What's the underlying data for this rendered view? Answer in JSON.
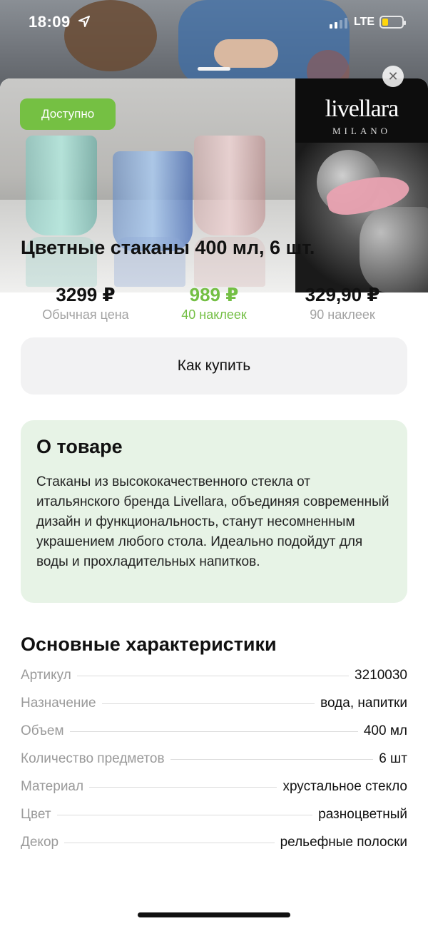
{
  "status_bar": {
    "time": "18:09",
    "network": "LTE"
  },
  "hero": {
    "badge": "Доступно",
    "brand": "livellara",
    "brand_sub": "MILANO"
  },
  "product": {
    "title": "Цветные стаканы 400 мл, 6 шт."
  },
  "prices": [
    {
      "value": "3299 ₽",
      "label": "Обычная цена"
    },
    {
      "value": "989 ₽",
      "label": "40 наклеек"
    },
    {
      "value": "329,90 ₽",
      "label": "90 наклеек"
    }
  ],
  "accent_color": "#74bf44",
  "how_to_buy_label": "Как купить",
  "about": {
    "title": "О товаре",
    "text": "Стаканы из высококачественного стекла от итальянского бренда Livellara, объединяя современный дизайн и функциональность, станут несомненным украшением любого стола. Идеально подойдут для воды и прохладительных напитков."
  },
  "specs": {
    "title": "Основные характеристики",
    "rows": [
      {
        "key": "Артикул",
        "value": "3210030"
      },
      {
        "key": "Назначение",
        "value": "вода, напитки"
      },
      {
        "key": "Объем",
        "value": "400 мл"
      },
      {
        "key": "Количество предметов",
        "value": "6 шт"
      },
      {
        "key": "Материал",
        "value": "хрустальное стекло"
      },
      {
        "key": "Цвет",
        "value": "разноцветный"
      },
      {
        "key": "Декор",
        "value": "рельефные полоски"
      }
    ]
  }
}
